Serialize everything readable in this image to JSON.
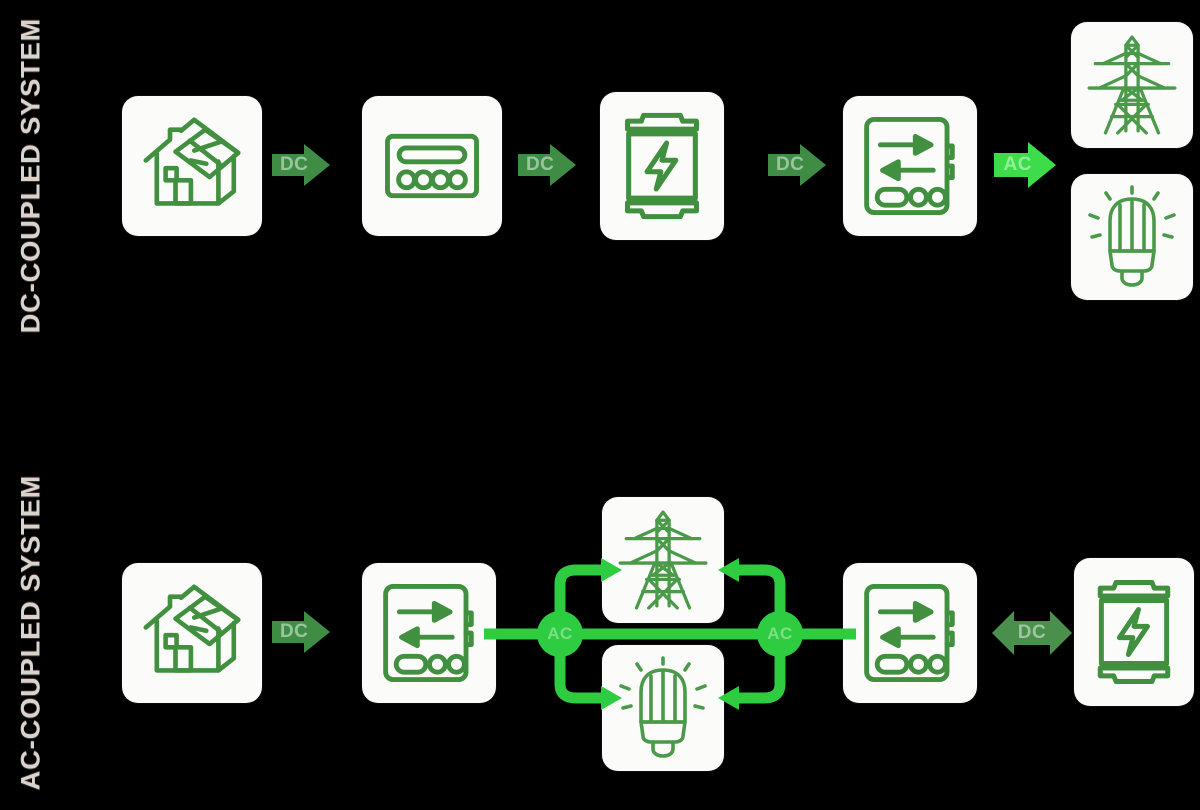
{
  "page": {
    "background": "#000000",
    "icon_green": "#41903f",
    "arrow_green_dark": "#3f8c44",
    "arrow_green_bright": "#3ddc4a",
    "bus_green": "#2ecc40",
    "tile_bg": "#fbfbfa",
    "label_color": "#d7d3cd"
  },
  "sections": [
    {
      "id": "dc",
      "label": "DC-COUPLED SYSTEM"
    },
    {
      "id": "ac",
      "label": "AC-COUPLED SYSTEM"
    }
  ],
  "dc_row": {
    "nodes": [
      {
        "name": "solar-house",
        "icon": "house-solar-icon",
        "caption": ""
      },
      {
        "name": "charge-controller",
        "icon": "charge-controller-icon",
        "caption": ""
      },
      {
        "name": "battery",
        "icon": "battery-bolt-icon",
        "caption": ""
      },
      {
        "name": "inverter",
        "icon": "inverter-icon",
        "caption": ""
      },
      {
        "name": "grid",
        "icon": "power-tower-icon",
        "caption": ""
      },
      {
        "name": "load",
        "icon": "light-bulb-icon",
        "caption": ""
      }
    ],
    "arrows": [
      {
        "name": "arrow-house-to-controller",
        "label": "DC",
        "style": "dark",
        "direction": "right"
      },
      {
        "name": "arrow-controller-to-battery",
        "label": "DC",
        "style": "dark",
        "direction": "right"
      },
      {
        "name": "arrow-battery-to-inverter",
        "label": "DC",
        "style": "dark",
        "direction": "right"
      },
      {
        "name": "arrow-inverter-to-loads",
        "label": "AC",
        "style": "bright",
        "direction": "right"
      }
    ]
  },
  "ac_row": {
    "nodes": [
      {
        "name": "solar-house",
        "icon": "house-solar-icon",
        "caption": ""
      },
      {
        "name": "solar-inverter",
        "icon": "inverter-icon",
        "caption": ""
      },
      {
        "name": "grid",
        "icon": "power-tower-icon",
        "caption": ""
      },
      {
        "name": "load",
        "icon": "light-bulb-icon",
        "caption": ""
      },
      {
        "name": "battery-inverter",
        "icon": "inverter-icon",
        "caption": ""
      },
      {
        "name": "battery",
        "icon": "battery-bolt-icon",
        "caption": ""
      }
    ],
    "arrows": [
      {
        "name": "arrow-house-to-inverter",
        "label": "DC",
        "style": "dark",
        "direction": "right"
      },
      {
        "name": "arrow-inverter-to-battery",
        "label": "DC",
        "style": "dark",
        "direction": "both"
      }
    ],
    "bus": {
      "name": "ac-bus",
      "left_node_label": "AC",
      "right_node_label": "AC"
    }
  }
}
